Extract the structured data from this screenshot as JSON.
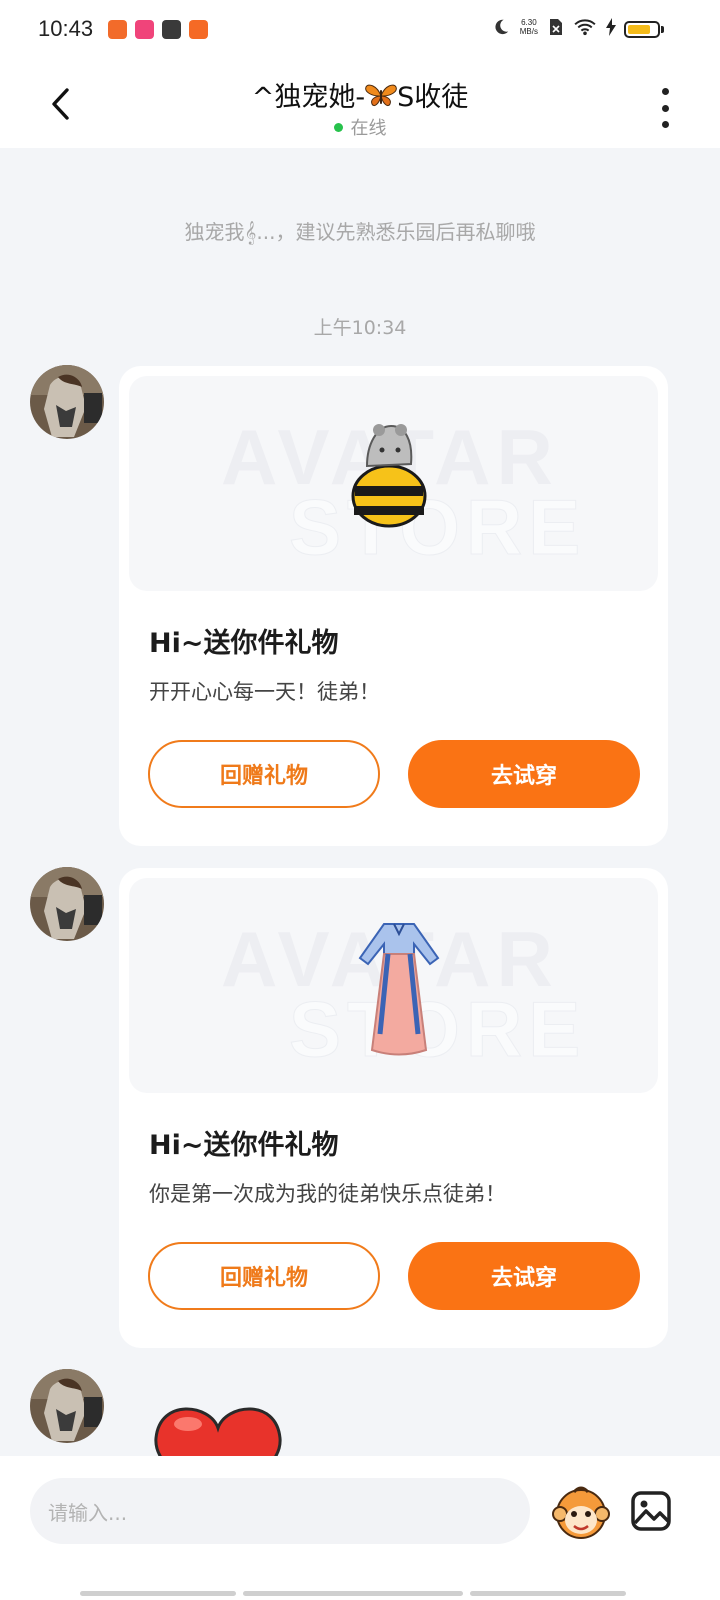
{
  "status_bar": {
    "time": "10:43",
    "net_speed_value": "6.30",
    "net_speed_unit": "MB/s",
    "battery_level": 0.8,
    "battery_color": "#f4bb1a",
    "icons": [
      "app-icon",
      "app-icon",
      "app-icon",
      "app-icon",
      "moon-icon",
      "no-sim-icon",
      "wifi-icon",
      "charging-icon",
      "battery-icon"
    ]
  },
  "header": {
    "title_prefix": "^独宠她-",
    "title_suffix": "S收徒",
    "status": "在线",
    "status_color": "#27c24c"
  },
  "chat": {
    "system_message": "独宠我𝄞...，建议先熟悉乐园后再私聊哦",
    "timestamp": "上午10:34",
    "gifts": [
      {
        "item_icon": "bee-costume",
        "title": "Hi~送你件礼物",
        "message": "开开心心每一天！徒弟！",
        "return_label": "回赠礼物",
        "try_label": "去试穿"
      },
      {
        "item_icon": "hanfu-dress",
        "title": "Hi~送你件礼物",
        "message": "你是第一次成为我的徒弟快乐点徒弟！",
        "return_label": "回赠礼物",
        "try_label": "去试穿"
      }
    ],
    "watermark_line1": "AVATAR",
    "watermark_line2": "STORE",
    "last_message_icon": "heart-sticker"
  },
  "input_bar": {
    "placeholder": "请输入..."
  },
  "colors": {
    "accent": "#fa7314",
    "background": "#f3f5f8"
  }
}
